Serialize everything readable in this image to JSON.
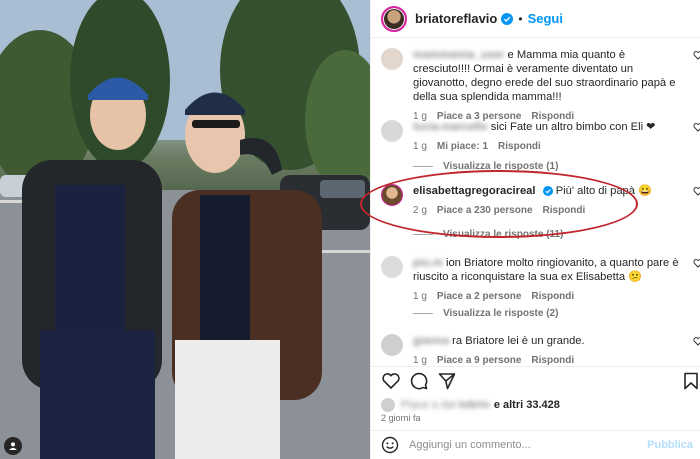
{
  "header": {
    "username": "briatoreflavio",
    "separator": "•",
    "follow_label": "Segui"
  },
  "comments": [
    {
      "user": "mammamia_user",
      "text": "e Mamma mia quanto è cresciuto!!!! Ormai è veramente diventato un giovanotto, degno erede del suo straordinario papà e della sua splendida mamma!!!",
      "age": "1 g",
      "likes": "Piace a 3 persone",
      "reply": "Rispondi"
    },
    {
      "user": "lucia.marcello",
      "text": "sici Fate un altro bimbo con Eli ❤",
      "age": "1 g",
      "likes": "Mi piace: 1",
      "reply": "Rispondi",
      "view_replies": "Visualizza le risposte (1)"
    },
    {
      "user": "elisabettagregoracireal",
      "text": "Più' alto di papà 😀",
      "age": "2 g",
      "likes": "Piace a 230 persone",
      "reply": "Rispondi",
      "view_replies": "Visualizza le risposte (11)"
    },
    {
      "user": "pio.m",
      "text": "ion Briatore molto ringiovanito, a quanto pare è riuscito a riconquistare la sua ex Elisabetta 😕",
      "age": "1 g",
      "likes": "Piace a 2 persone",
      "reply": "Rispondi",
      "view_replies": "Visualizza le risposte (2)"
    },
    {
      "user": "gianna",
      "text": "ra Briatore lei è un grande.",
      "age": "1 g",
      "likes": "Piace a 9 persone",
      "reply": "Rispondi"
    }
  ],
  "likes_summary": {
    "prefix": "Piace a dar",
    "user": "tobrio",
    "suffix": "e altri 33.428"
  },
  "date": "2 giorni fa",
  "composer": {
    "placeholder": "Aggiungi un commento...",
    "publish_label": "Pubblica"
  },
  "colors": {
    "accent": "#0095f6",
    "highlight_oval": "#c1272d",
    "like_heart": "#ed4956"
  },
  "icons": [
    "heart-icon",
    "comment-icon",
    "share-icon",
    "bookmark-icon",
    "verified-icon",
    "emoji-icon",
    "user-tag-icon"
  ]
}
